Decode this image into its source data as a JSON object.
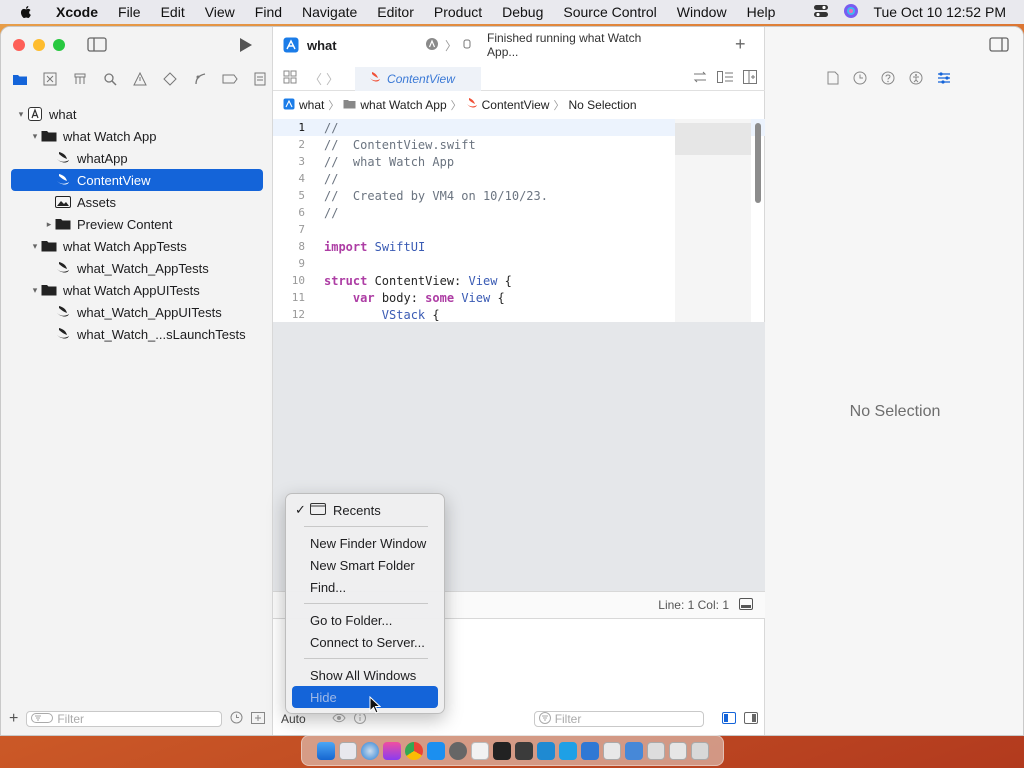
{
  "menubar": {
    "app": "Xcode",
    "items": [
      "File",
      "Edit",
      "View",
      "Find",
      "Navigate",
      "Editor",
      "Product",
      "Debug",
      "Source Control",
      "Window",
      "Help"
    ],
    "datetime": "Tue Oct 10  12:52 PM"
  },
  "toolbar": {
    "project_name": "what",
    "status": "Finished running what Watch App..."
  },
  "tab": {
    "title": "ContentView"
  },
  "breadcrumb": [
    "what",
    "what Watch App",
    "ContentView",
    "No Selection"
  ],
  "navigator": {
    "items": [
      {
        "label": "what",
        "level": 0,
        "disclosure": "v",
        "icon": "app-icon"
      },
      {
        "label": "what Watch App",
        "level": 1,
        "disclosure": "v",
        "icon": "folder-icon"
      },
      {
        "label": "whatApp",
        "level": 2,
        "disclosure": "",
        "icon": "swift-file-icon"
      },
      {
        "label": "ContentView",
        "level": 2,
        "disclosure": "",
        "icon": "swift-file-icon",
        "selected": true
      },
      {
        "label": "Assets",
        "level": 2,
        "disclosure": "",
        "icon": "asset-catalog-icon"
      },
      {
        "label": "Preview Content",
        "level": 2,
        "disclosure": ">",
        "icon": "folder-icon"
      },
      {
        "label": "what Watch AppTests",
        "level": 1,
        "disclosure": "v",
        "icon": "folder-icon"
      },
      {
        "label": "what_Watch_AppTests",
        "level": 2,
        "disclosure": "",
        "icon": "swift-file-icon"
      },
      {
        "label": "what Watch AppUITests",
        "level": 1,
        "disclosure": "v",
        "icon": "folder-icon"
      },
      {
        "label": "what_Watch_AppUITests",
        "level": 2,
        "disclosure": "",
        "icon": "swift-file-icon"
      },
      {
        "label": "what_Watch_...sLaunchTests",
        "level": 2,
        "disclosure": "",
        "icon": "swift-file-icon"
      }
    ],
    "filter_placeholder": "Filter"
  },
  "code": {
    "lines": [
      {
        "n": "1",
        "t": "//"
      },
      {
        "n": "2",
        "t": "//  ContentView.swift"
      },
      {
        "n": "3",
        "t": "//  what Watch App"
      },
      {
        "n": "4",
        "t": "//"
      },
      {
        "n": "5",
        "t": "//  Created by VM4 on 10/10/23."
      },
      {
        "n": "6",
        "t": "//"
      },
      {
        "n": "7",
        "t": ""
      },
      {
        "n": "8",
        "t": "import SwiftUI"
      },
      {
        "n": "9",
        "t": ""
      },
      {
        "n": "10",
        "t": "struct ContentView: View {"
      },
      {
        "n": "11",
        "t": "    var body: some View {"
      },
      {
        "n": "12",
        "t": "        VStack {"
      }
    ]
  },
  "status": {
    "line_col": "Line: 1  Col: 1"
  },
  "debug": {
    "auto_label": "Auto",
    "filter_placeholder": "Filter"
  },
  "inspector": {
    "empty_text": "No Selection"
  },
  "context_menu": {
    "items": [
      {
        "label": "Recents",
        "checked": true,
        "icon": "window-icon"
      },
      {
        "sep": true
      },
      {
        "label": "New Finder Window"
      },
      {
        "label": "New Smart Folder"
      },
      {
        "label": "Find..."
      },
      {
        "sep": true
      },
      {
        "label": "Go to Folder..."
      },
      {
        "label": "Connect to Server..."
      },
      {
        "sep": true
      },
      {
        "label": "Show All Windows"
      },
      {
        "label": "Hide",
        "highlighted": true
      }
    ]
  },
  "colors": {
    "accent": "#1464d9",
    "keyword": "#ad3da4",
    "type": "#3a5bb4",
    "comment": "#6b7480"
  }
}
